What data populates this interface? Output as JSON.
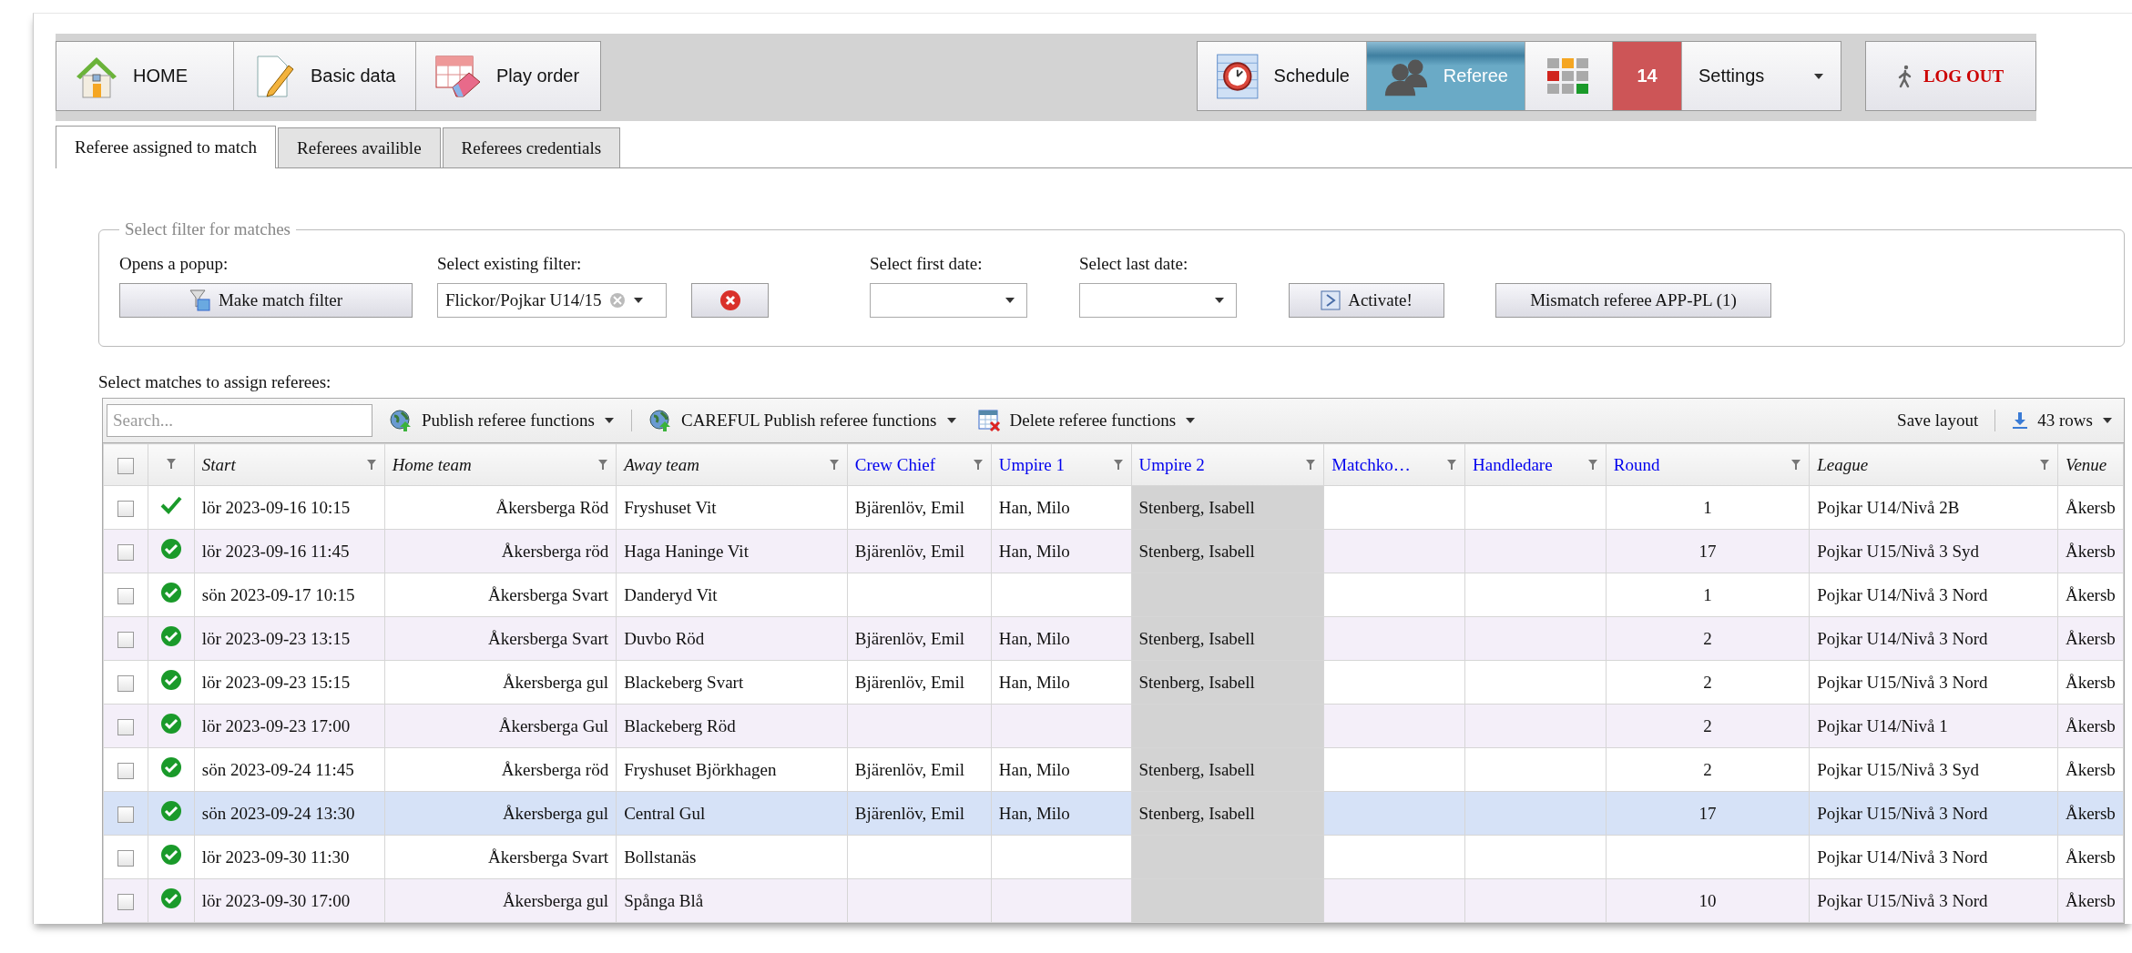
{
  "nav": {
    "left": [
      {
        "label": "HOME",
        "selected": false
      },
      {
        "label": "Basic data",
        "selected": false
      },
      {
        "label": "Play order",
        "selected": false
      }
    ],
    "right": [
      {
        "kind": "button",
        "label": "Schedule",
        "selected": false
      },
      {
        "kind": "button",
        "label": "Referee",
        "selected": true
      },
      {
        "kind": "apps",
        "selected": false
      },
      {
        "kind": "badge",
        "label": "14",
        "selected": false
      },
      {
        "kind": "dropdown",
        "label": "Settings",
        "selected": false
      }
    ],
    "logout": {
      "label": "LOG OUT"
    }
  },
  "tabs": [
    {
      "label": "Referee assigned to match",
      "selected": true
    },
    {
      "label": "Referees availible",
      "selected": false
    },
    {
      "label": "Referees credentials",
      "selected": false
    }
  ],
  "filter": {
    "legend": "Select filter for matches",
    "popup_label": "Opens a popup:",
    "make_filter_button": "Make match filter",
    "existing_filter_label": "Select existing filter:",
    "existing_filter_value": "Flickor/Pojkar U14/15",
    "first_date_label": "Select first date:",
    "last_date_label": "Select last date:",
    "activate_button": "Activate!",
    "mismatch_button": "Mismatch referee APP-PL (1)"
  },
  "grid": {
    "title": "Select matches to assign referees:",
    "search": {
      "placeholder": "Search..."
    },
    "actions": [
      "Publish referee functions",
      "CAREFUL Publish referee functions",
      "Delete referee functions"
    ],
    "save_layout": "Save layout",
    "row_count": "43 rows",
    "select_all": {
      "checked": false
    },
    "columns": [
      {
        "kind": "checkbox",
        "filter": false
      },
      {
        "kind": "status",
        "filter": true
      },
      {
        "kind": "plain",
        "label": "Start",
        "filter": true
      },
      {
        "kind": "plain",
        "label": "Home team",
        "filter": true
      },
      {
        "kind": "plain",
        "label": "Away team",
        "filter": true
      },
      {
        "kind": "link",
        "label": "Crew Chief",
        "filter": true
      },
      {
        "kind": "link",
        "label": "Umpire 1",
        "filter": true
      },
      {
        "kind": "link",
        "label": "Umpire 2",
        "filter": true,
        "shaded": true
      },
      {
        "kind": "link",
        "label": "Matchko…",
        "filter": true
      },
      {
        "kind": "link",
        "label": "Handledare",
        "filter": true
      },
      {
        "kind": "link",
        "label": "Round",
        "filter": true
      },
      {
        "kind": "plain",
        "label": "League",
        "filter": true
      },
      {
        "kind": "plain",
        "label": "Venue",
        "filter": false
      }
    ],
    "rows": [
      {
        "checked": false,
        "selected": false,
        "kind": "tick",
        "start": "lör 2023-09-16 10:15",
        "home": "Åkersberga Röd",
        "away": "Fryshuset Vit",
        "crew_chief": "Bjärenlöv, Emil",
        "umpire_1": "Han, Milo",
        "umpire_2": "Stenberg, Isabell",
        "round": "1",
        "league": "Pojkar U14/Nivå 2B",
        "venue": "Åkersb"
      },
      {
        "checked": false,
        "selected": false,
        "kind": "check-circle",
        "start": "lör 2023-09-16 11:45",
        "home": "Åkersberga röd",
        "away": "Haga Haninge Vit",
        "crew_chief": "Bjärenlöv, Emil",
        "umpire_1": "Han, Milo",
        "umpire_2": "Stenberg, Isabell",
        "round": "17",
        "league": "Pojkar U15/Nivå 3 Syd",
        "venue": "Åkersb"
      },
      {
        "checked": false,
        "selected": false,
        "kind": "check-circle",
        "start": "sön 2023-09-17 10:15",
        "home": "Åkersberga Svart",
        "away": "Danderyd Vit",
        "round": "1",
        "league": "Pojkar U14/Nivå 3 Nord",
        "venue": "Åkersb"
      },
      {
        "checked": false,
        "selected": false,
        "kind": "check-circle",
        "start": "lör 2023-09-23 13:15",
        "home": "Åkersberga Svart",
        "away": "Duvbo Röd",
        "crew_chief": "Bjärenlöv, Emil",
        "umpire_1": "Han, Milo",
        "umpire_2": "Stenberg, Isabell",
        "round": "2",
        "league": "Pojkar U14/Nivå 3 Nord",
        "venue": "Åkersb"
      },
      {
        "checked": false,
        "selected": false,
        "kind": "check-circle",
        "start": "lör 2023-09-23 15:15",
        "home": "Åkersberga gul",
        "away": "Blackeberg Svart",
        "crew_chief": "Bjärenlöv, Emil",
        "umpire_1": "Han, Milo",
        "umpire_2": "Stenberg, Isabell",
        "round": "2",
        "league": "Pojkar U15/Nivå 3 Nord",
        "venue": "Åkersb"
      },
      {
        "checked": false,
        "selected": false,
        "kind": "check-circle",
        "start": "lör 2023-09-23 17:00",
        "home": "Åkersberga Gul",
        "away": "Blackeberg Röd",
        "round": "2",
        "league": "Pojkar U14/Nivå 1",
        "venue": "Åkersb"
      },
      {
        "checked": false,
        "selected": false,
        "kind": "check-circle",
        "start": "sön 2023-09-24 11:45",
        "home": "Åkersberga röd",
        "away": "Fryshuset Björkhagen",
        "crew_chief": "Bjärenlöv, Emil",
        "umpire_1": "Han, Milo",
        "umpire_2": "Stenberg, Isabell",
        "round": "2",
        "league": "Pojkar U15/Nivå 3 Syd",
        "venue": "Åkersb"
      },
      {
        "checked": false,
        "selected": true,
        "kind": "check-circle",
        "start": "sön 2023-09-24 13:30",
        "home": "Åkersberga gul",
        "away": "Central Gul",
        "crew_chief": "Bjärenlöv, Emil",
        "umpire_1": "Han, Milo",
        "umpire_2": "Stenberg, Isabell",
        "round": "17",
        "league": "Pojkar U15/Nivå 3 Nord",
        "venue": "Åkersb"
      },
      {
        "checked": false,
        "selected": false,
        "kind": "check-circle",
        "start": "lör 2023-09-30 11:30",
        "home": "Åkersberga Svart",
        "away": "Bollstanäs",
        "league": "Pojkar U14/Nivå 3 Nord",
        "venue": "Åkersb"
      },
      {
        "checked": false,
        "selected": false,
        "kind": "check-circle",
        "start": "lör 2023-09-30 17:00",
        "home": "Åkersberga gul",
        "away": "Spånga Blå",
        "round": "10",
        "league": "Pojkar U15/Nivå 3 Nord",
        "venue": "Åkersb"
      }
    ]
  }
}
